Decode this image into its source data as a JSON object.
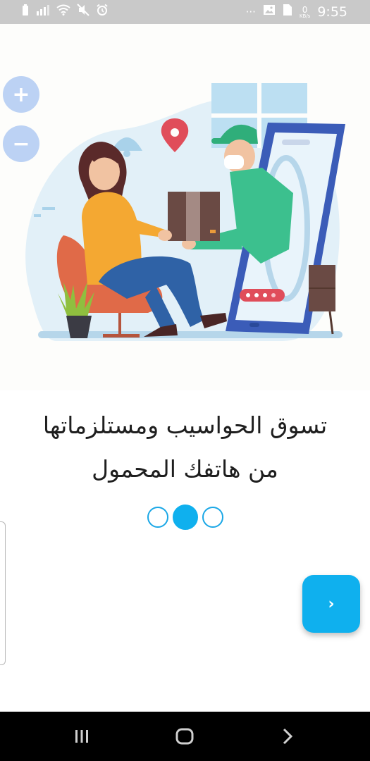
{
  "status_bar": {
    "icons_left": [
      "battery-saver-icon",
      "signal-icon",
      "wifi-icon",
      "mute-icon",
      "alarm-icon"
    ],
    "more": "···",
    "net_speed_value": "0",
    "net_speed_unit": "KB/s",
    "time": "9:55",
    "icons_right": [
      "gallery-icon",
      "sim-icon"
    ]
  },
  "illustration": {
    "name": "delivery-illustration",
    "zoom_in": "+",
    "zoom_out": "−"
  },
  "onboarding": {
    "headline_line1": "تسوق الحواسيب ومستلزماتها",
    "headline_line2": "من هاتفك المحمول",
    "pages_total": 3,
    "active_page": 2,
    "next_icon": "›"
  },
  "nav_bar": {
    "buttons": [
      "recents-icon",
      "home-icon",
      "back-icon"
    ]
  },
  "colors": {
    "accent": "#0FB0EE",
    "status_bar": "#C9C9C9",
    "nav_bar": "#000000",
    "zoom_button": "#BCD2F4",
    "headline": "#1E1E1E"
  }
}
